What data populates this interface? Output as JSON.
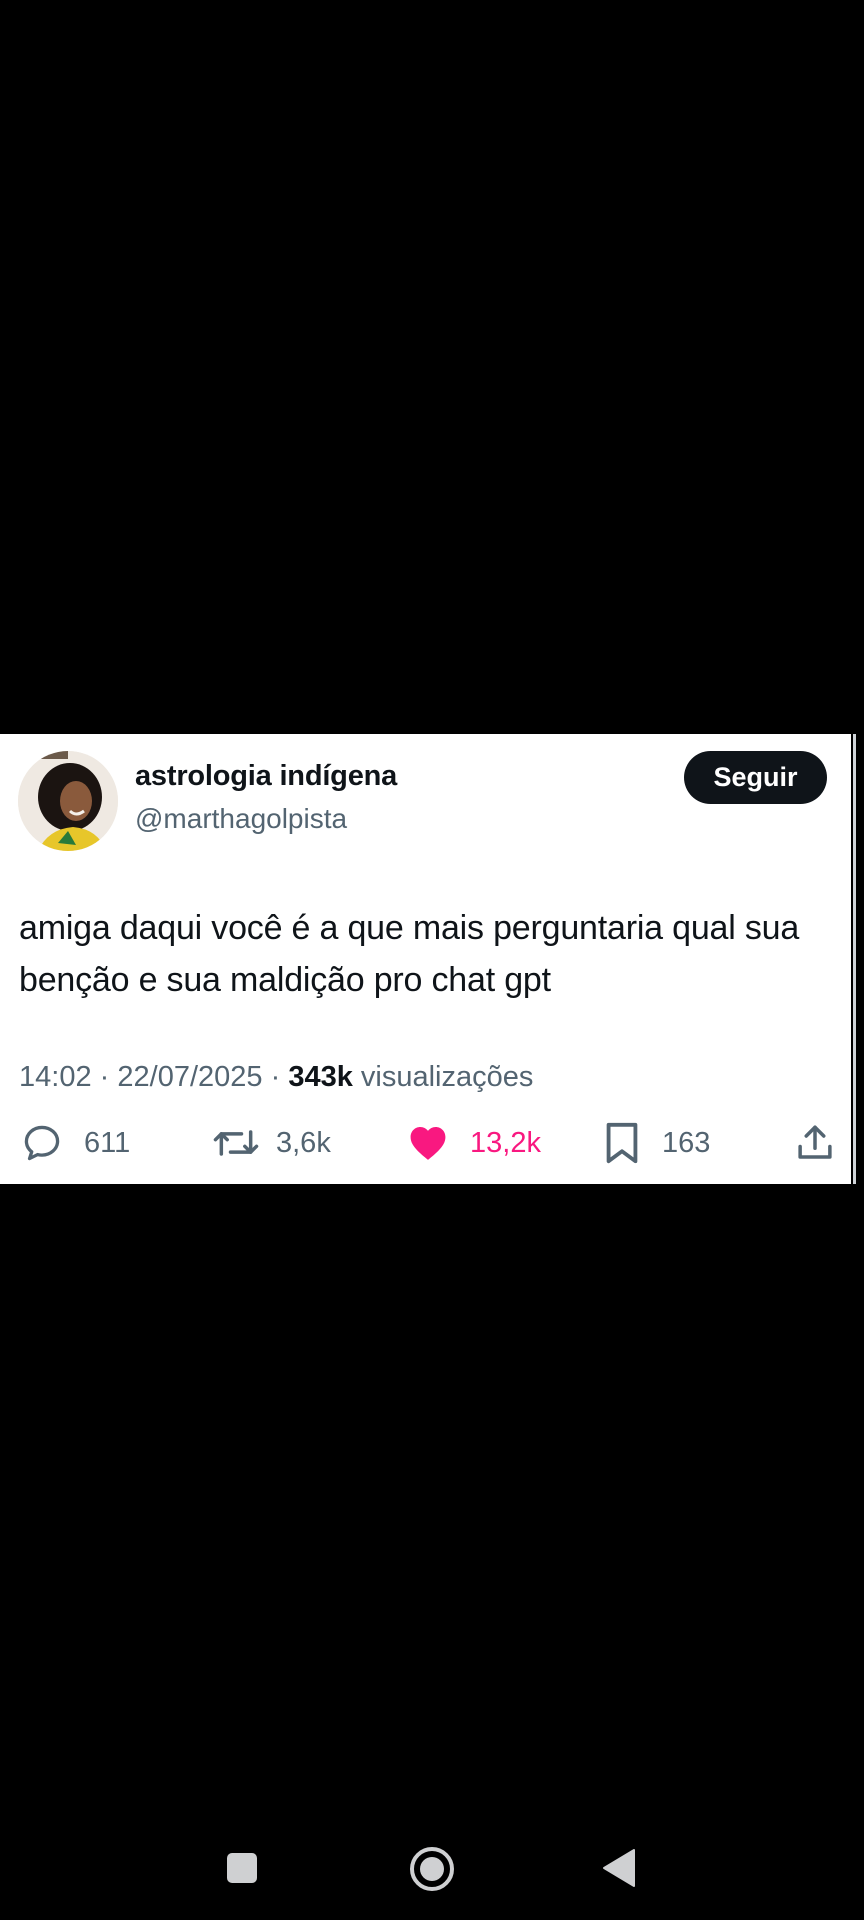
{
  "tweet": {
    "author": {
      "display_name": "astrologia indígena",
      "handle": "@marthagolpista"
    },
    "follow_label": "Seguir",
    "text": "amiga daqui você é a que mais perguntaria qual sua benção e sua maldição pro chat gpt",
    "time": "14:02",
    "date": "22/07/2025",
    "views_count": "343k",
    "views_label": "visualizações",
    "separator": "·"
  },
  "actions": {
    "replies": "611",
    "reposts": "3,6k",
    "likes": "13,2k",
    "bookmarks": "163"
  },
  "colors": {
    "like_accent": "#f91880",
    "text_primary": "#0f1419",
    "text_secondary": "#536471"
  },
  "icons": [
    "reply-icon",
    "repost-icon",
    "heart-icon",
    "bookmark-icon",
    "share-icon",
    "recent-apps-icon",
    "home-icon",
    "back-icon"
  ]
}
